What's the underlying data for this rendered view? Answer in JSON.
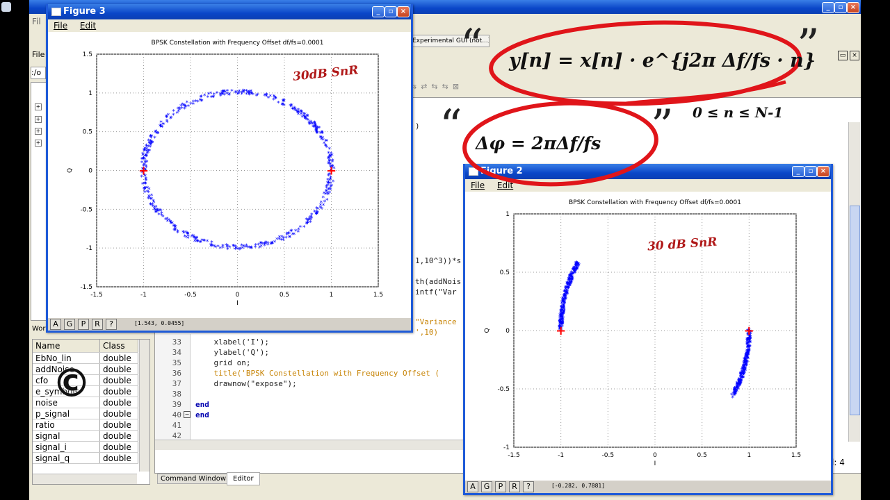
{
  "left_margin_icon": "app-icon",
  "main_window": {
    "menu_file_fragment": "Fil",
    "sidebar_fragments": [
      "File",
      ":/o"
    ],
    "tab_title": "Experimental GUI (not...)",
    "workspace_fragment": "Wor",
    "status_fragment": "l: 4"
  },
  "workspace": {
    "columns": [
      "Name",
      "Class"
    ],
    "rows": [
      {
        "name": "EbNo_lin",
        "class": "double"
      },
      {
        "name": "addNoise",
        "class": "double"
      },
      {
        "name": "cfo",
        "class": "double"
      },
      {
        "name": "e_symbols",
        "class": "double"
      },
      {
        "name": "noise",
        "class": "double"
      },
      {
        "name": "p_signal",
        "class": "double"
      },
      {
        "name": "ratio",
        "class": "double"
      },
      {
        "name": "signal",
        "class": "double"
      },
      {
        "name": "signal_i",
        "class": "double"
      },
      {
        "name": "signal_q",
        "class": "double"
      }
    ],
    "copyright_symbol": "©"
  },
  "editor": {
    "partial_lines": [
      {
        "text": ")"
      },
      {
        "text": "1,10^3))*s"
      },
      {
        "text": "th(addNois"
      },
      {
        "text": "intf(\"Var"
      },
      {
        "text": "\"Variance"
      },
      {
        "text": "',10)"
      }
    ],
    "lines": [
      {
        "num": "33",
        "text": "    xlabel('I');"
      },
      {
        "num": "34",
        "text": "    ylabel('Q');"
      },
      {
        "num": "35",
        "text": "    grid on;"
      },
      {
        "num": "36",
        "text": "    title('BPSK Constellation with Frequency Offset ("
      },
      {
        "num": "37",
        "text": "    drawnow(\"expose\");"
      },
      {
        "num": "38",
        "text": ""
      },
      {
        "num": "39",
        "text": "end"
      },
      {
        "num": "40",
        "text": "end"
      },
      {
        "num": "41",
        "text": ""
      },
      {
        "num": "42",
        "text": ""
      }
    ],
    "tabs": [
      "Command Window",
      "Editor"
    ],
    "active_tab": "Editor"
  },
  "figure3": {
    "title": "Figure 3",
    "menu": [
      "File",
      "Edit"
    ],
    "status_buttons": [
      "A",
      "G",
      "P",
      "R",
      "?"
    ],
    "coords": "[1.543, 0.0455]",
    "annotation": "30dB SnR"
  },
  "figure2": {
    "title": "Figure 2",
    "menu": [
      "File",
      "Edit"
    ],
    "status_buttons": [
      "A",
      "G",
      "P",
      "R",
      "?"
    ],
    "coords": "[-0.282, 0.7881]",
    "annotation": "30 dB SnR"
  },
  "overlays": {
    "formula1": "y[n] = x[n] · e^{j2π Δf/fs · n}",
    "formula2": "Δφ = 2πΔf/fs",
    "range": "0 ≤ n ≤ N-1",
    "quote_open": "“",
    "quote_close": "”",
    "ring_color": "#e0151a"
  },
  "chart_data": [
    {
      "type": "scatter",
      "title": "BPSK Constellation with Frequency Offset df/fs=0.0001",
      "xlabel": "I",
      "ylabel": "Q",
      "xlim": [
        -1.5,
        1.5
      ],
      "ylim": [
        -1.5,
        1.5
      ],
      "xticks": [
        "-1.5",
        "-1",
        "-0.5",
        "0",
        "0.5",
        "1",
        "1.5"
      ],
      "yticks": [
        "1.5",
        "1",
        "0.5",
        "0",
        "-0.5",
        "-1",
        "-1.5"
      ],
      "grid": true,
      "series": [
        {
          "marker": "*",
          "color": "#0000ff",
          "shape": "ring",
          "radius": 1.0,
          "noise_spread": 0.03,
          "count": 500
        },
        {
          "marker": "+",
          "color": "#ff0000",
          "points": [
            [
              -1,
              0
            ],
            [
              1,
              0
            ]
          ]
        }
      ]
    },
    {
      "type": "scatter",
      "title": "BPSK Constellation with Frequency Offset df/fs=0.0001",
      "xlabel": "I",
      "ylabel": "Q",
      "xlim": [
        -1.5,
        1.5
      ],
      "ylim": [
        -1,
        1
      ],
      "xticks": [
        "-1.5",
        "-1",
        "-0.5",
        "0",
        "0.5",
        "1",
        "1.5"
      ],
      "yticks": [
        "1",
        "0.5",
        "0",
        "-0.5",
        "-1"
      ],
      "grid": true,
      "series": [
        {
          "marker": "*",
          "color": "#0000ff",
          "shape": "arc",
          "radius": 1.0,
          "angle_start_deg": 180,
          "angle_end_deg": 145,
          "noise_spread": 0.02,
          "count": 250
        },
        {
          "marker": "*",
          "color": "#0000ff",
          "shape": "arc",
          "radius": 1.0,
          "angle_start_deg": 0,
          "angle_end_deg": -35,
          "noise_spread": 0.02,
          "count": 250
        },
        {
          "marker": "+",
          "color": "#ff0000",
          "points": [
            [
              -1,
              0
            ],
            [
              1,
              0
            ]
          ]
        }
      ]
    }
  ]
}
